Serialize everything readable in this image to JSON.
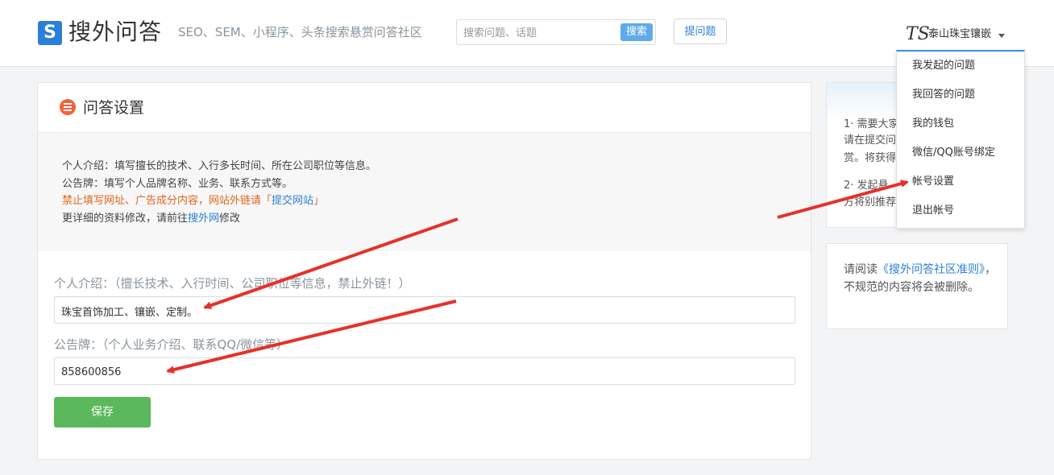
{
  "header": {
    "logo_letter": "S",
    "logo_text": "搜外问答",
    "slogan": "SEO、SEM、小程序、头条搜索悬赏问答社区",
    "search_placeholder": "搜索问题、话题",
    "search_button": "搜索",
    "ask_button": "提问题",
    "user_avatar_text": "TS",
    "user_name": "泰山珠宝镶嵌"
  },
  "user_menu": {
    "items": [
      "我发起的问题",
      "我回答的问题",
      "我的钱包",
      "微信/QQ账号绑定",
      "帐号设置",
      "退出帐号"
    ]
  },
  "panel": {
    "title": "问答设置",
    "tips": {
      "line1": "个人介绍：填写擅长的技术、入行多长时间、所在公司职位等信息。",
      "line2": "公告牌：填写个人品牌名称、业务、联系方式等。",
      "line3_text": "禁止填写网址、广告成分内容，网站外链请「",
      "line3_link": "提交网站",
      "line3_end": "」",
      "line4_text": "更详细的资料修改，请前往",
      "line4_link": "搜外网",
      "line4_end": "修改"
    },
    "intro": {
      "label": "个人介绍：（擅长技术、入行时间、公司职位等信息，禁止外链！）",
      "value": "珠宝首饰加工、镶嵌、定制。"
    },
    "notice": {
      "label": "公告牌：（个人业务介绍、联系QQ/微信等）",
      "value": "858600856"
    },
    "save_button": "保存"
  },
  "side_box1": {
    "line1": "1· 需要大家",
    "line2": "请在提交问",
    "line3": "赏。将获得",
    "line4": "2· 发起悬",
    "line5": "方将别推荐"
  },
  "side_box2": {
    "prefix": "请阅读",
    "link": "《搜外问答社区准则》",
    "suffix": "，不规范的内容将会被删除。"
  },
  "colors": {
    "brand_blue": "#2c7fd8",
    "save_green": "#5cb85c",
    "warn_orange": "#e4641c",
    "annotation_red": "#e8302a"
  }
}
